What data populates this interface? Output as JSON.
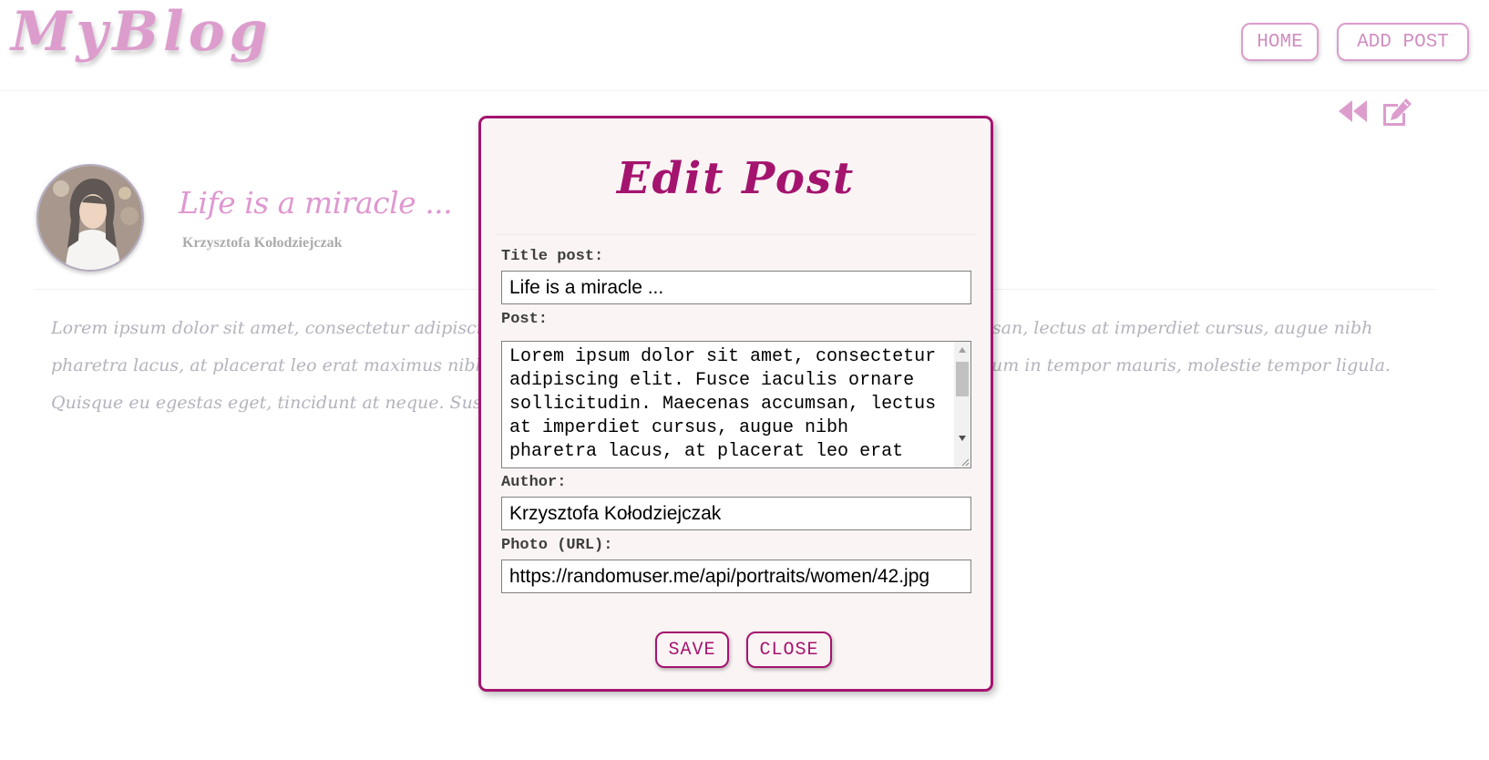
{
  "header": {
    "logo": "MyBlog",
    "nav": {
      "home": "HOME",
      "add_post": "ADD POST"
    }
  },
  "post_toolbar": {
    "back_icon": "rewind-icon",
    "edit_icon": "edit-icon"
  },
  "post": {
    "title": "Life is a miracle ...",
    "author": "Krzysztofa Kołodziejczak",
    "body_visible": "Lorem ipsum dolor sit amet, consectetur adipiscing elit. Fusce iaculis ornare sollicitudin. Maecenas accumsan, lectus at imperdiet cursus, augue nibh pharetra lacus, at placerat leo erat maximus nibh. Nunc tincidunt lorem, a porta tortor sodales at. Vestibulum in tempor mauris, molestie tempor ligula. Quisque eu egestas eget, tincidunt at neque. Suspendisse a suscipit."
  },
  "modal": {
    "title": "Edit Post",
    "labels": {
      "title": "Title post:",
      "post": "Post:",
      "author": "Author:",
      "photo": "Photo (URL):"
    },
    "values": {
      "title": "Life is a miracle ...",
      "post": "Lorem ipsum dolor sit amet, consectetur adipiscing elit. Fusce iaculis ornare sollicitudin. Maecenas accumsan, lectus at imperdiet cursus, augue nibh pharetra lacus, at placerat leo erat",
      "author": "Krzysztofa Kołodziejczak",
      "photo": "https://randomuser.me/api/portraits/women/42.jpg"
    },
    "buttons": {
      "save": "SAVE",
      "close": "CLOSE"
    }
  },
  "colors": {
    "brand_pink": "#d07dbd",
    "modal_accent": "#a4146f",
    "modal_bg": "#fbf4f4"
  }
}
